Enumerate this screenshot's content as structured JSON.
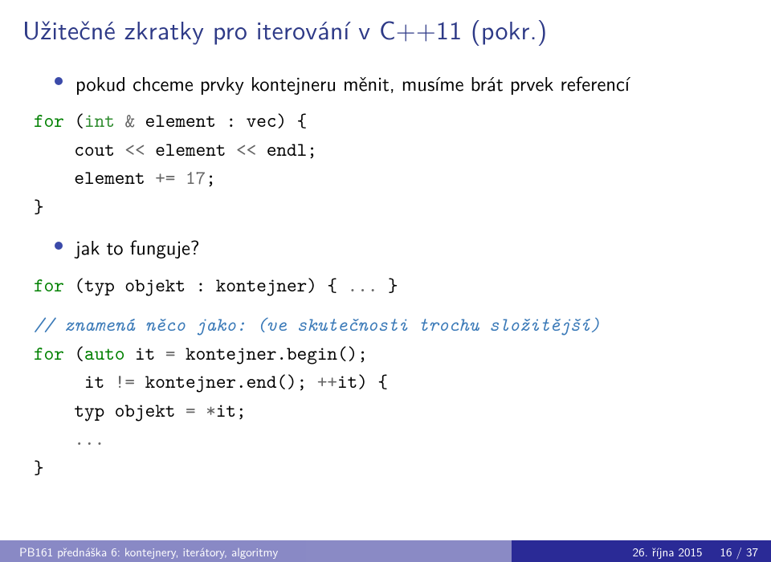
{
  "title": "Užitečné zkratky pro iterování v C++11 (pokr.)",
  "bullets": {
    "b1": "pokud chceme prvky kontejneru měnit, musíme brát prvek referencí",
    "b2": "jak to funguje?"
  },
  "code1": {
    "l1a": "for",
    "l1b": " (",
    "l1c": "int",
    "l1d": " ",
    "l1e": "&",
    "l1f": " element : vec) {",
    "l2a": "    cout ",
    "l2b": "<<",
    "l2c": " element ",
    "l2d": "<<",
    "l2e": " endl;",
    "l3a": "    element ",
    "l3b": "+=",
    "l3c": " ",
    "l3d": "17",
    "l3e": ";",
    "l4": "}"
  },
  "code2": {
    "l1a": "for",
    "l1b": " (typ objekt : kontejner) { ",
    "l1c": "...",
    "l1d": " }"
  },
  "code3": {
    "l1": "// znamená něco jako: (ve skutečnosti trochu složitější)",
    "l2a": "for",
    "l2b": " (",
    "l2c": "auto",
    "l2d": " it ",
    "l2e": "=",
    "l2f": " kontejner.begin();",
    "l3a": "     it ",
    "l3b": "!=",
    "l3c": " kontejner.end(); ",
    "l3d": "++",
    "l3e": "it) {",
    "l4a": "    typ objekt ",
    "l4b": "=",
    "l4c": " ",
    "l4d": "*",
    "l4e": "it;",
    "l5a": "    ",
    "l5b": "...",
    "l6": "}"
  },
  "footer": {
    "left": "PB161 přednáška 6: kontejnery, iterátory, algoritmy",
    "date": "26. října 2015",
    "page": "16 / 37"
  }
}
